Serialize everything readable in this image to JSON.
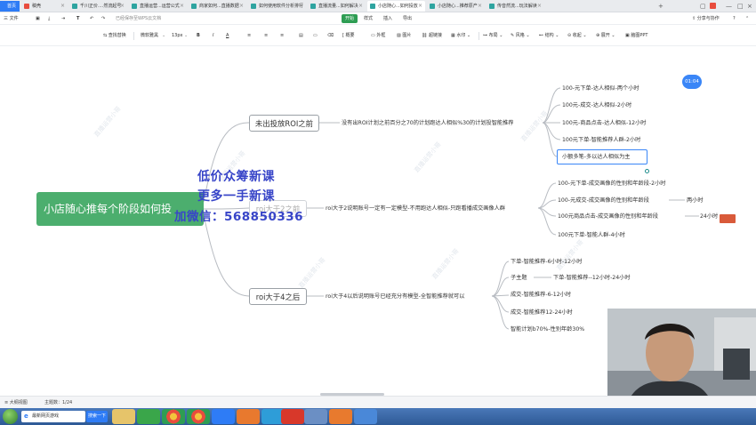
{
  "browser_tabs": [
    {
      "label": "首页",
      "kind": "home"
    },
    {
      "label": "稿壳",
      "kind": "red"
    },
    {
      "label": "千川正价....然流起号",
      "kind": "normal"
    },
    {
      "label": "直播运营...运营公式",
      "kind": "normal"
    },
    {
      "label": "商家如何...直播数据",
      "kind": "normal"
    },
    {
      "label": "如何使用软件分析排行",
      "kind": "normal"
    },
    {
      "label": "直播流量...如何解决",
      "kind": "normal"
    },
    {
      "label": "小店随心...如何投放",
      "kind": "active"
    },
    {
      "label": "小店随心...推荐原产",
      "kind": "normal"
    },
    {
      "label": "传音然流...玩法解读",
      "kind": "normal"
    }
  ],
  "window_controls": [
    "+",
    "—",
    "□",
    "×"
  ],
  "menu": {
    "file": "三 文件",
    "saved_status": "已经保存至WPS云文档",
    "tabs": [
      "开始",
      "样式",
      "插入",
      "导出"
    ],
    "share": "分享与协作",
    "help": "?"
  },
  "toolbar": {
    "find_replace": "查找替换",
    "font": "微软雅黑",
    "size": "13px",
    "bold": "B",
    "italic": "I",
    "font_color": "A",
    "outline": "概要",
    "frame": "外框",
    "image": "图片",
    "hyperlink": "超链接",
    "watermark": "水印",
    "layout": "布局",
    "style": "风格",
    "structure": "结构",
    "collapse": "收起",
    "expand": "展开",
    "export_ppt": "脑图PPT"
  },
  "mindmap": {
    "root": "小店随心推每个阶段如何投",
    "branches": [
      {
        "label": "未出投放ROI之前",
        "desc": "没有出ROI计划之前百分之70的计划跑达人相似%30的计划投智能推荐",
        "children": [
          "100-元下单-达人相似-两个小时",
          "100元-成交-达人相似-2小时",
          "100元-商品点击-达人相似-12小时",
          "100元下单-智能推荐人群-2小时",
          "小额多笔-多以达人相似为主"
        ]
      },
      {
        "label": "roi大于2之前",
        "desc": "roi大于2说明账号一定有一定模型-不用跑达人相似-只跑看播成交画像人群",
        "children": [
          "100-元下单-成交画像的性别和年龄段-2小时",
          "100-元成交-成交画像的性别和年龄段",
          "100元商品点击-成交画像的性别和年龄段",
          "100元下单-智能人群-4小时"
        ],
        "tails": [
          "两小时",
          "24小时"
        ]
      },
      {
        "label": "roi大于4之后",
        "desc": "roi大于4以后说明账号已经充分有模型-全智能推荐就可以",
        "children": [
          "下单-智能推荐-6小时-12小时",
          "子主题",
          "成交-智能推荐-6-12小时",
          "成交-智能推荐12-24小时",
          "智能计划b70%-性别年龄30%"
        ],
        "subtopic_child": "下单-智能推荐--12小时-24小时"
      }
    ]
  },
  "promo": {
    "line1": "低价众筹新课",
    "line2": "更多一手新课",
    "line3": "加微信：568850336"
  },
  "watermark_text": "直播运营小哥",
  "timer": "01:04",
  "statusbar": {
    "outline_view": "大纲视图",
    "topic_count": "主题数：1/24"
  },
  "taskbar": {
    "search_text": "最新网页游戏",
    "search_button": "搜索一下"
  },
  "colors": {
    "root_green": "#4cae6e",
    "accent_blue": "#3a86f7",
    "promo_blue": "#3845c8",
    "branch_line": "#b8bcc2"
  }
}
